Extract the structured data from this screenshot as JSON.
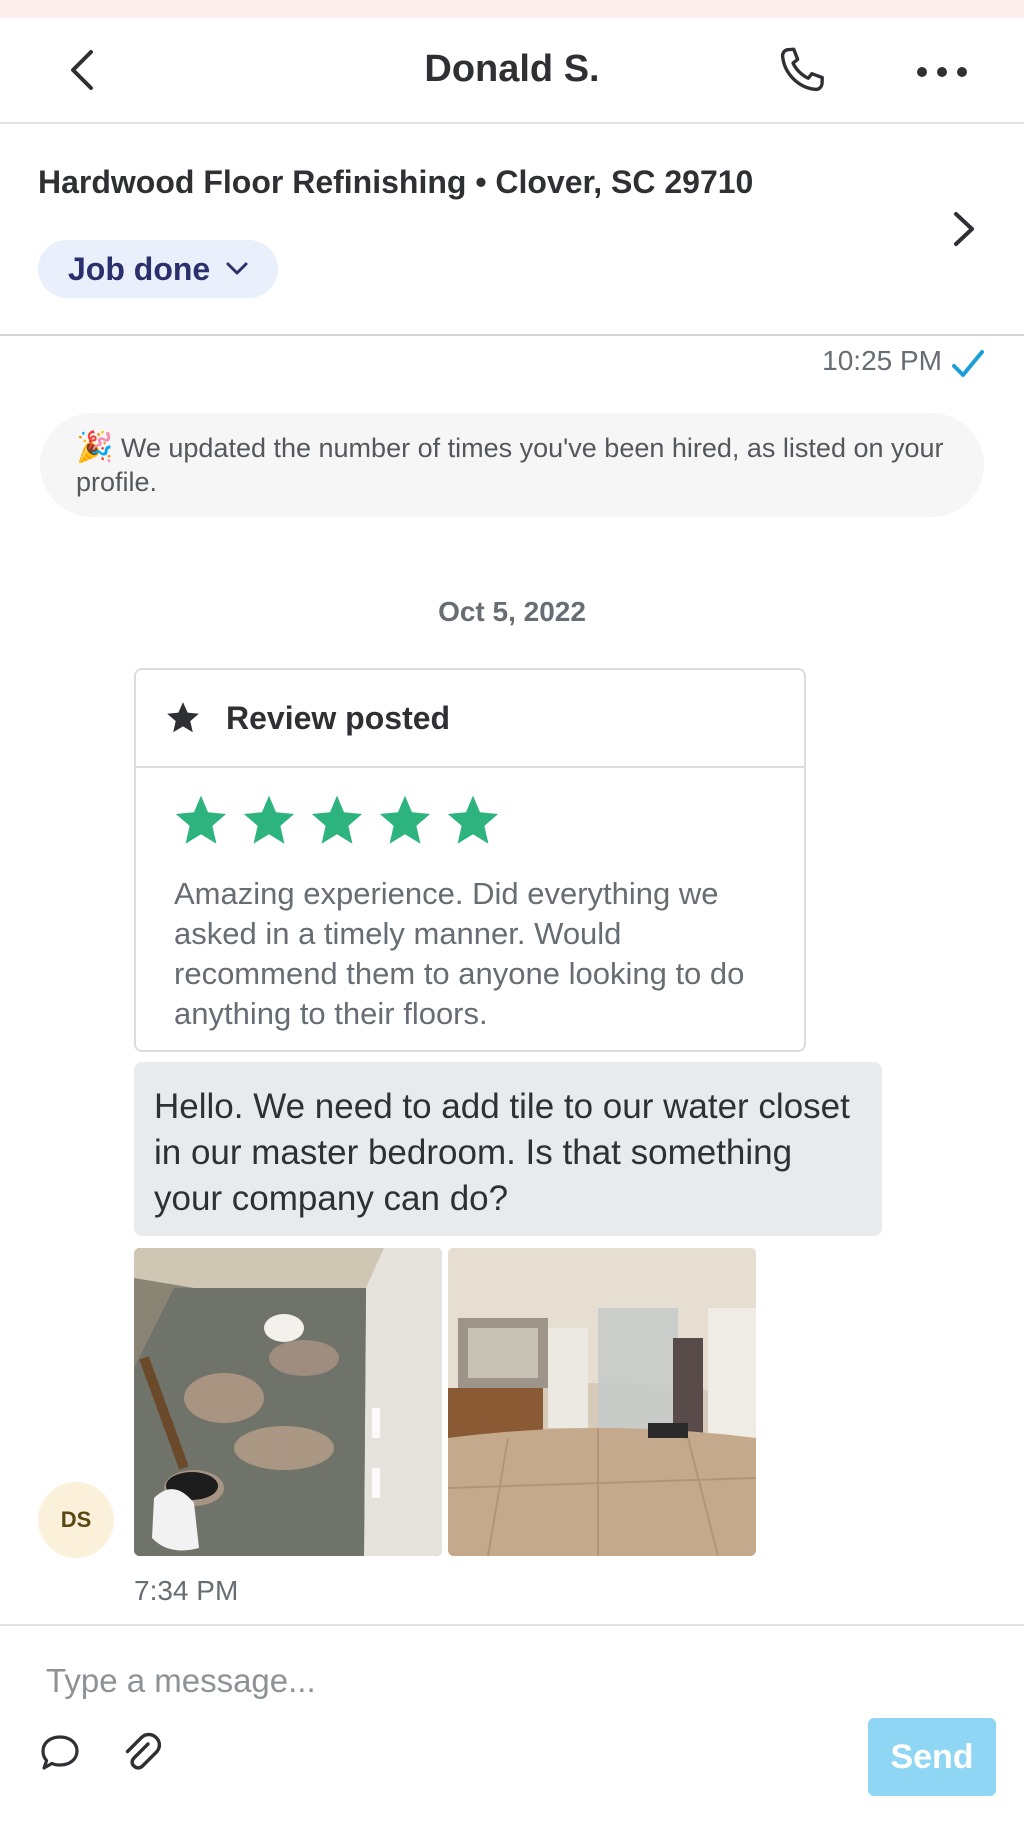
{
  "header": {
    "contact_name": "Donald S.",
    "icons": {
      "back": "chevron-left-icon",
      "call": "phone-icon",
      "menu": "more-dots-icon"
    }
  },
  "job": {
    "title": "Hardwood Floor Refinishing • Clover, SC 29710",
    "status": "Job done",
    "icons": {
      "status_dropdown": "chevron-down-icon",
      "details": "chevron-right-icon"
    }
  },
  "thread": {
    "first_timestamp": "10:25 PM",
    "read_icon": "checkmark-icon",
    "system_notice": {
      "emoji": "🎉",
      "text": "We updated the number of times you've been hired, as listed on your profile."
    },
    "date_divider": "Oct 5, 2022",
    "review": {
      "title": "Review posted",
      "rating": 5,
      "max_rating": 5,
      "text": "Amazing experience. Did everything we asked in a timely manner. Would recommend them to anyone looking to do anything to their floors.",
      "star_color": "#2db37e"
    },
    "message": {
      "text": "Hello. We need to add tile to our water closet in our master bedroom. Is that something your company can do?",
      "sender_initials": "DS",
      "timestamp": "7:34 PM",
      "photos": [
        "bathroom-floor-photo",
        "master-bathroom-photo"
      ]
    }
  },
  "composer": {
    "placeholder": "Type a message...",
    "send_label": "Send",
    "icons": {
      "quick_replies": "chat-bubble-icon",
      "attach": "paperclip-icon"
    }
  },
  "colors": {
    "accent_blue": "#1b9fd9",
    "send_button": "#8fd6f4",
    "status_pill_bg": "#e9effb",
    "status_pill_text": "#2b2f6c"
  }
}
